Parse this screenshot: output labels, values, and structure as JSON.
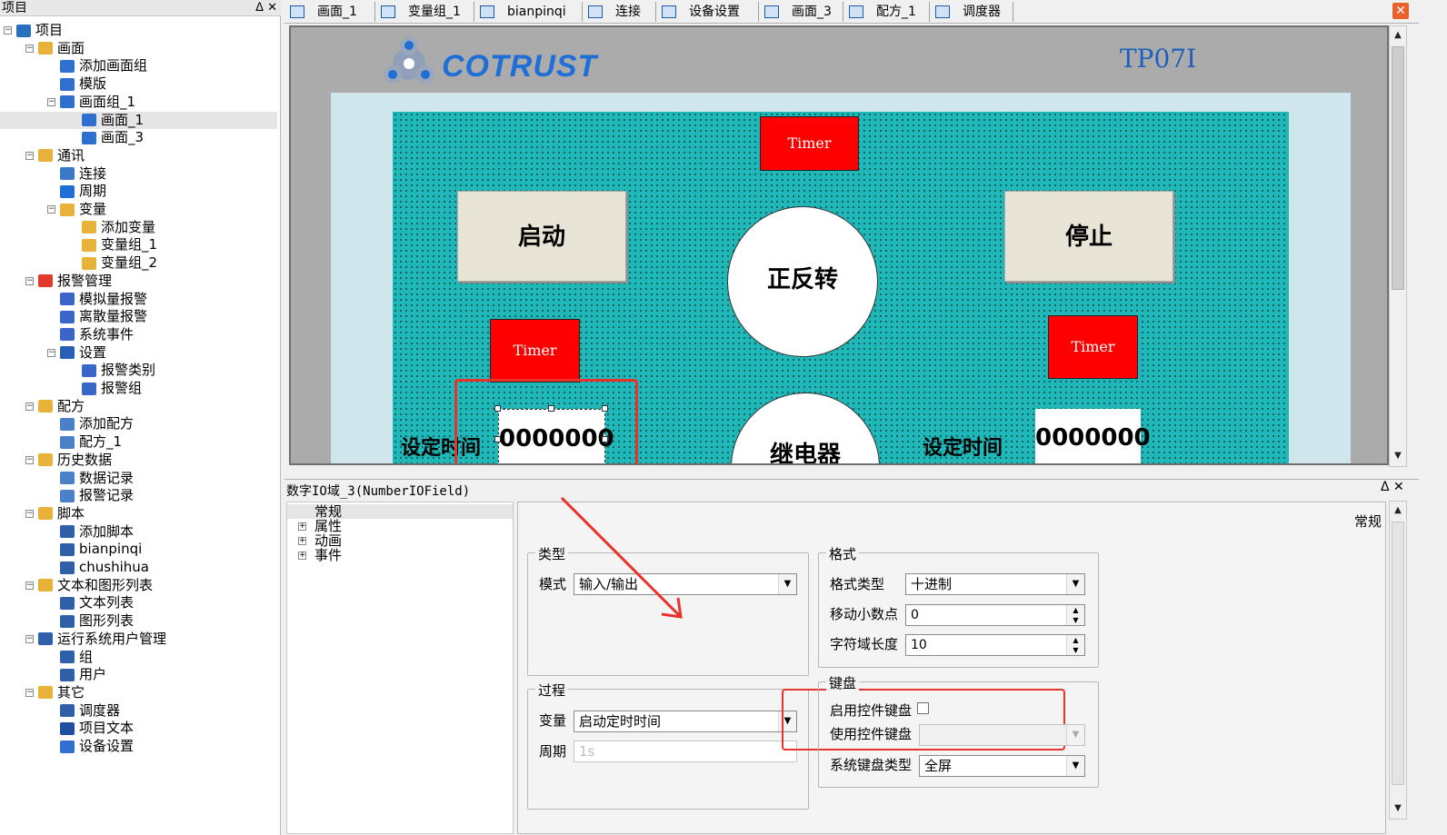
{
  "left_panel": {
    "title": "项目",
    "title_buttons": "ᐃ ✕",
    "tree": [
      {
        "label": "项目",
        "icon": "project-icon",
        "color": "#2a6fbd"
      },
      {
        "label": "画面",
        "icon": "screen-folder-icon",
        "color": "#e8b23a"
      },
      {
        "label": "添加画面组",
        "icon": "add-screen-group-icon",
        "color": "#2e6fd0"
      },
      {
        "label": "模版",
        "icon": "template-icon",
        "color": "#2e6fd0"
      },
      {
        "label": "画面组_1",
        "icon": "screen-group-icon",
        "color": "#2e6fd0"
      },
      {
        "label": "画面_1",
        "icon": "screen-icon",
        "color": "#2e6fd0"
      },
      {
        "label": "画面_3",
        "icon": "screen-icon",
        "color": "#2e6fd0"
      },
      {
        "label": "通讯",
        "icon": "communication-icon",
        "color": "#e8b23a"
      },
      {
        "label": "连接",
        "icon": "connection-icon",
        "color": "#3a78c8"
      },
      {
        "label": "周期",
        "icon": "cycle-icon",
        "color": "#1f6fd6"
      },
      {
        "label": "变量",
        "icon": "variable-folder-icon",
        "color": "#e8b23a"
      },
      {
        "label": "添加变量",
        "icon": "add-variable-icon",
        "color": "#e8b23a"
      },
      {
        "label": "变量组_1",
        "icon": "variable-group-icon",
        "color": "#e8b23a"
      },
      {
        "label": "变量组_2",
        "icon": "variable-group-icon",
        "color": "#e8b23a"
      },
      {
        "label": "报警管理",
        "icon": "alarm-management-icon",
        "color": "#e13a2a"
      },
      {
        "label": "模拟量报警",
        "icon": "analog-alarm-icon",
        "color": "#3a66c8"
      },
      {
        "label": "离散量报警",
        "icon": "discrete-alarm-icon",
        "color": "#3a66c8"
      },
      {
        "label": "系统事件",
        "icon": "system-event-icon",
        "color": "#3a66c8"
      },
      {
        "label": "设置",
        "icon": "settings-icon",
        "color": "#2a5fb8"
      },
      {
        "label": "报警类别",
        "icon": "alarm-class-icon",
        "color": "#3a66c8"
      },
      {
        "label": "报警组",
        "icon": "alarm-group-icon",
        "color": "#3a66c8"
      },
      {
        "label": "配方",
        "icon": "recipe-folder-icon",
        "color": "#e8b23a"
      },
      {
        "label": "添加配方",
        "icon": "add-recipe-icon",
        "color": "#4a80c8"
      },
      {
        "label": "配方_1",
        "icon": "recipe-icon",
        "color": "#4a80c8"
      },
      {
        "label": "历史数据",
        "icon": "history-data-icon",
        "color": "#e8b23a"
      },
      {
        "label": "数据记录",
        "icon": "data-log-icon",
        "color": "#4a80c8"
      },
      {
        "label": "报警记录",
        "icon": "alarm-log-icon",
        "color": "#4a80c8"
      },
      {
        "label": "脚本",
        "icon": "script-folder-icon",
        "color": "#e8b23a"
      },
      {
        "label": "添加脚本",
        "icon": "add-script-icon",
        "color": "#2e5fa8"
      },
      {
        "label": "bianpinqi",
        "icon": "script-icon",
        "color": "#2e5fa8"
      },
      {
        "label": "chushihua",
        "icon": "script-icon",
        "color": "#2e5fa8"
      },
      {
        "label": "文本和图形列表",
        "icon": "text-graphic-list-icon",
        "color": "#e8b23a"
      },
      {
        "label": "文本列表",
        "icon": "text-list-icon",
        "color": "#2e5fa8"
      },
      {
        "label": "图形列表",
        "icon": "graphic-list-icon",
        "color": "#2e5fa8"
      },
      {
        "label": "运行系统用户管理",
        "icon": "user-management-icon",
        "color": "#2e5fa8"
      },
      {
        "label": "组",
        "icon": "group-icon",
        "color": "#2e5fa8"
      },
      {
        "label": "用户",
        "icon": "user-icon",
        "color": "#2e5fa8"
      },
      {
        "label": "其它",
        "icon": "other-folder-icon",
        "color": "#e8b23a"
      },
      {
        "label": "调度器",
        "icon": "scheduler-icon",
        "color": "#2e5fa8"
      },
      {
        "label": "项目文本",
        "icon": "project-text-icon",
        "color": "#1f4fa0"
      },
      {
        "label": "设备设置",
        "icon": "device-settings-icon",
        "color": "#2e6fd0"
      }
    ]
  },
  "tabs": [
    {
      "label": "画面_1"
    },
    {
      "label": "变量组_1"
    },
    {
      "label": "bianpinqi"
    },
    {
      "label": "连接"
    },
    {
      "label": "设备设置"
    },
    {
      "label": "画面_3"
    },
    {
      "label": "配方_1"
    },
    {
      "label": "调度器"
    }
  ],
  "close_glyph": "✕",
  "hmi": {
    "brand": "COTRUST",
    "model": "TP07I",
    "timer_top": "Timer",
    "timer_left": "Timer",
    "timer_right": "Timer",
    "start_button": "启动",
    "stop_button": "停止",
    "circle_top": "正反转",
    "circle_bottom": "继电器",
    "set_time_left": "设定时间",
    "set_time_right": "设定时间",
    "num_left": "0000000",
    "num_right": "0000000"
  },
  "property_pane": {
    "title": "数字IO域_3(NumberIOField)",
    "title_buttons": "ᐃ ✕",
    "tree": [
      {
        "label": "常规",
        "expandable": false
      },
      {
        "label": "属性",
        "expandable": true
      },
      {
        "label": "动画",
        "expandable": true
      },
      {
        "label": "事件",
        "expandable": true
      }
    ],
    "section_heading": "常规",
    "type_group": {
      "title": "类型",
      "mode_label": "模式",
      "mode_value": "输入/输出"
    },
    "format_group": {
      "title": "格式",
      "format_type_label": "格式类型",
      "format_type_value": "十进制",
      "shift_decimal_label": "移动小数点",
      "shift_decimal_value": "0",
      "field_length_label": "字符域长度",
      "field_length_value": "10"
    },
    "process_group": {
      "title": "过程",
      "variable_label": "变量",
      "variable_value": "启动定时时间",
      "cycle_label": "周期",
      "cycle_value": "1s"
    },
    "keyboard_group": {
      "title": "键盘",
      "enable_keyboard_label": "启用控件键盘",
      "enable_keyboard_checked": false,
      "use_keyboard_label": "使用控件键盘",
      "use_keyboard_value": "",
      "sys_keyboard_label": "系统键盘类型",
      "sys_keyboard_value": "全屏"
    }
  },
  "colors": {
    "screen_bg": "#1fb7b7",
    "timer_red": "#ff0000",
    "annotation_red": "#e8322b",
    "brand_blue": "#1f6fd6"
  }
}
